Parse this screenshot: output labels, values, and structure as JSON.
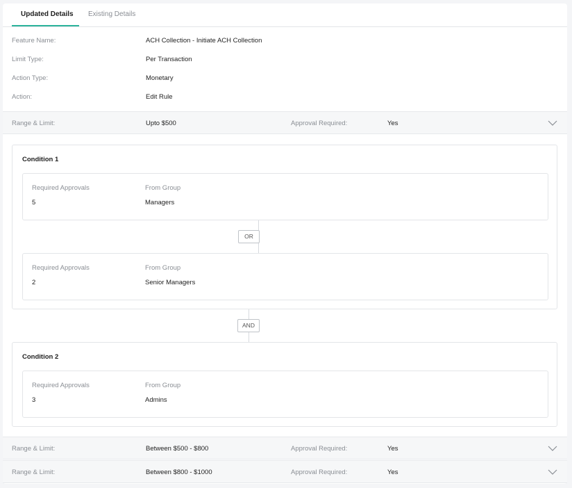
{
  "tabs": [
    {
      "label": "Updated Details"
    },
    {
      "label": "Existing Details"
    }
  ],
  "details": {
    "feature_name_label": "Feature Name:",
    "feature_name_value": "ACH Collection - Initiate ACH Collection",
    "limit_type_label": "Limit Type:",
    "limit_type_value": "Per Transaction",
    "action_type_label": "Action Type:",
    "action_type_value": "Monetary",
    "action_label": "Action:",
    "action_value": "Edit Rule"
  },
  "ranges": [
    {
      "range_label": "Range & Limit:",
      "range_value": "Upto $500",
      "approval_label": "Approval Required:",
      "approval_value": "Yes",
      "expanded": true
    },
    {
      "range_label": "Range & Limit:",
      "range_value": "Between $500 - $800",
      "approval_label": "Approval Required:",
      "approval_value": "Yes",
      "expanded": false
    },
    {
      "range_label": "Range & Limit:",
      "range_value": "Between $800 - $1000",
      "approval_label": "Approval Required:",
      "approval_value": "Yes",
      "expanded": false
    }
  ],
  "conditions": [
    {
      "title": "Condition 1",
      "approvals": [
        {
          "required_label": "Required Approvals",
          "required_value": "5",
          "group_label": "From Group",
          "group_value": "Managers"
        },
        {
          "required_label": "Required Approvals",
          "required_value": "2",
          "group_label": "From Group",
          "group_value": "Senior Managers"
        }
      ],
      "inner_operator": "OR"
    },
    {
      "title": "Condition 2",
      "approvals": [
        {
          "required_label": "Required Approvals",
          "required_value": "3",
          "group_label": "From Group",
          "group_value": "Admins"
        }
      ]
    }
  ],
  "condition_operator": "AND",
  "colors": {
    "accent": "#2bb39b"
  }
}
